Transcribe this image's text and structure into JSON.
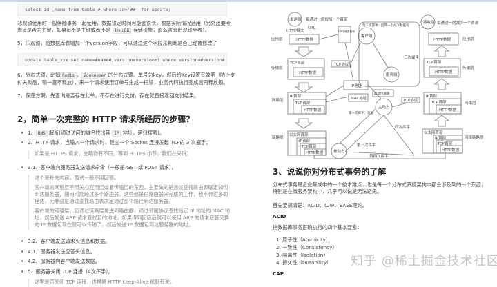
{
  "left": {
    "code1": "select id ,name from table_# where id='##'  for update;",
    "para1_line1": "悲观锁使用时一般伴随事务一起使用，数据锁定时间可能会很长，根据实际情况选用（另外还要考",
    "para1_line2_a": "虑id是否为主键，如果id不是主键或者不是",
    "para1_line2_code": "InnoDB",
    "para1_line2_b": "存储引擎，那么就会出现锁全表）。",
    "item5": "5，乐观锁，给数据库表增加一个version字段，可以通过这个字段来判断是否已经被修改了",
    "code2": "update table_xxx set name=#name#,version=version+1 where version=#version#",
    "item6_a": "6，分布式锁，比如",
    "item6_code1": "Redis",
    "item6_sep": "、",
    "item6_code2": "Zookeeper",
    "item6_b": "的分布式锁。单号为key，然后给Key设置有效期（防止支",
    "item6_line2": "付失败后，锁一直不释放），来一个请求使用订单号生成一把锁，业务代码执行完成后再释放锁。",
    "item7": "7，保底方案，先查询是否存在此单，不存在进行支付，存在就直接返回支付结果。",
    "heading2": "2，简单一次完整的 HTTP 请求所经历的步骤？",
    "step1_a": "1、",
    "step1_code1": "DNS",
    "step1_b": "解析(通过访问的域名找出其",
    "step1_code2": "IP",
    "step1_c": "地址，递归搜索)。",
    "step2": "2、HTTP 请求，当输入一个请求时，建立一个 Socket 连接发起 TCP的 3 次握手。",
    "quote1": "如果是 HTTPS 请求，会略微有不同。等到 HTTPS 小节，我们在来讲。",
    "step31": "3.1、客户端向服务器发送请求命令（一般是 GET 或 POST 请求）。",
    "quote2": [
      "这个是补充内容，面试一般不用回答。",
      "客户端的网络层不用关心应用层或者传输层的东西，主要做的是通过查找路由表确定如何",
      "到达服务器，期间可能经过多个路由器，这些都是由路由器来完成的工作，我不作过多的",
      "描述，无非就是通过查找路由表决定通过那个路径到达服务器。",
      "客户端的链路层，包通过链路层发送到路由器，通过邻居协议查找给定 IP 地址的 MAC 地",
      "址，然后发送 ARP 请求查找目的地址，如果得到回应后就可以使用 ARP 的请求应答交换",
      "的 IP 数据包现在就可以传输了，然后发送 IP 数据包到达服务器的地址。"
    ],
    "step32": "3.2、客户端发送请求头信息和数据。",
    "step41": "4.1、服务器发送应答头信息。",
    "step42": "4.2、服务器向客户端发送数据。",
    "step5": "5、服务器关闭 TCP 连接（4次挥手）。",
    "quote3": "这里是否关闭 TCP 连接，也根据 HTTP Keep-Alive 机制有关。"
  },
  "diagram": {
    "sender": "发送端",
    "sender_note": "每通过一层增加一个首部",
    "receiver": "接收端",
    "receiver_note": "每通过一层减少一个首部",
    "http_msg": "HTTP报文",
    "url": "URL",
    "http_data": "HTTP数据",
    "dns": "DNS域名解析",
    "tcp_header": "TCP首部",
    "ip_header": "IP首部",
    "eth_header": "以太网首部",
    "tcp_proto": "TCP协议",
    "client": "客户端",
    "server": "服务端",
    "third_hs": "第三次握手：回传一个ACK数据包",
    "three_hs": "三次握手",
    "ip_addr": "IP地址",
    "mac_addr": "MAC地址",
    "best_path": "最优传输路",
    "active": "主动方",
    "passive": "被动方",
    "four_wave": "四次挥手",
    "fourth_wave": "第四次挥手",
    "third_wave": "第三次挥手",
    "first_wave": "第一次挥手：发送",
    "layer_app": "应用层",
    "layer_transport": "传输层",
    "layer_network": "网络层",
    "layer_link": "链路层",
    "layer_netlink": "网络链路层"
  },
  "right": {
    "heading3": "3、说说你对分布式事务的了解",
    "p1_line1": "分布式事务是企业集成中的一个技术难点，也是每一个分布式系统架构中都会涉及到的一个东西，",
    "p1_line2": "特别是在微服务架构中，几乎可以说是无法避免。",
    "p2": "首先要搞清楚：ACID、CAP、BASE理论。",
    "acid": "ACID",
    "p3": "指数据库事务正确执行的四个基本要素：",
    "list": [
      "1. 原子性（Atomicity）",
      "2. 一致性（Consistency）",
      "3. 隔离性（Isolation）",
      "4. 持久性（Durability）"
    ],
    "cap": "CAP"
  },
  "watermark": "知乎 @稀土掘金技术社区"
}
